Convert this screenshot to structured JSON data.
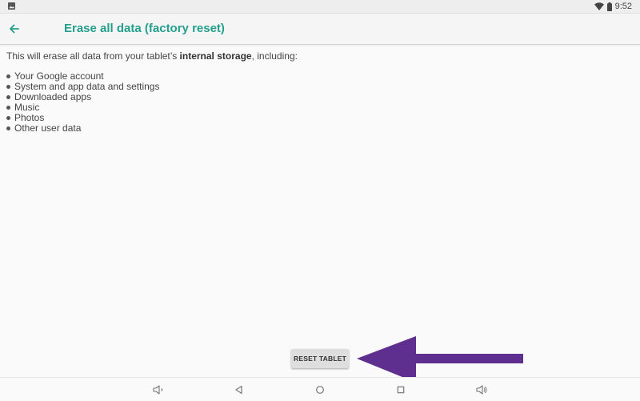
{
  "status_bar": {
    "time": "9:52",
    "icons": [
      "image-icon",
      "wifi-icon",
      "battery-icon"
    ]
  },
  "app_bar": {
    "title": "Erase all data (factory reset)",
    "back_icon": "arrow-back-icon",
    "accent_color": "#239f8c"
  },
  "content": {
    "intro_prefix": "This will erase all data from your tablet’s ",
    "intro_bold": "internal storage",
    "intro_suffix": ", including:",
    "items": [
      "Your Google account",
      "System and app data and settings",
      "Downloaded apps",
      "Music",
      "Photos",
      "Other user data"
    ]
  },
  "reset_button": {
    "label": "RESET TABLET"
  },
  "annotation": {
    "arrow_color": "#5f2f8f"
  },
  "nav_bar": {
    "icons": [
      "volume-down-icon",
      "back-triangle-icon",
      "home-circle-icon",
      "recents-square-icon",
      "volume-up-icon"
    ]
  }
}
